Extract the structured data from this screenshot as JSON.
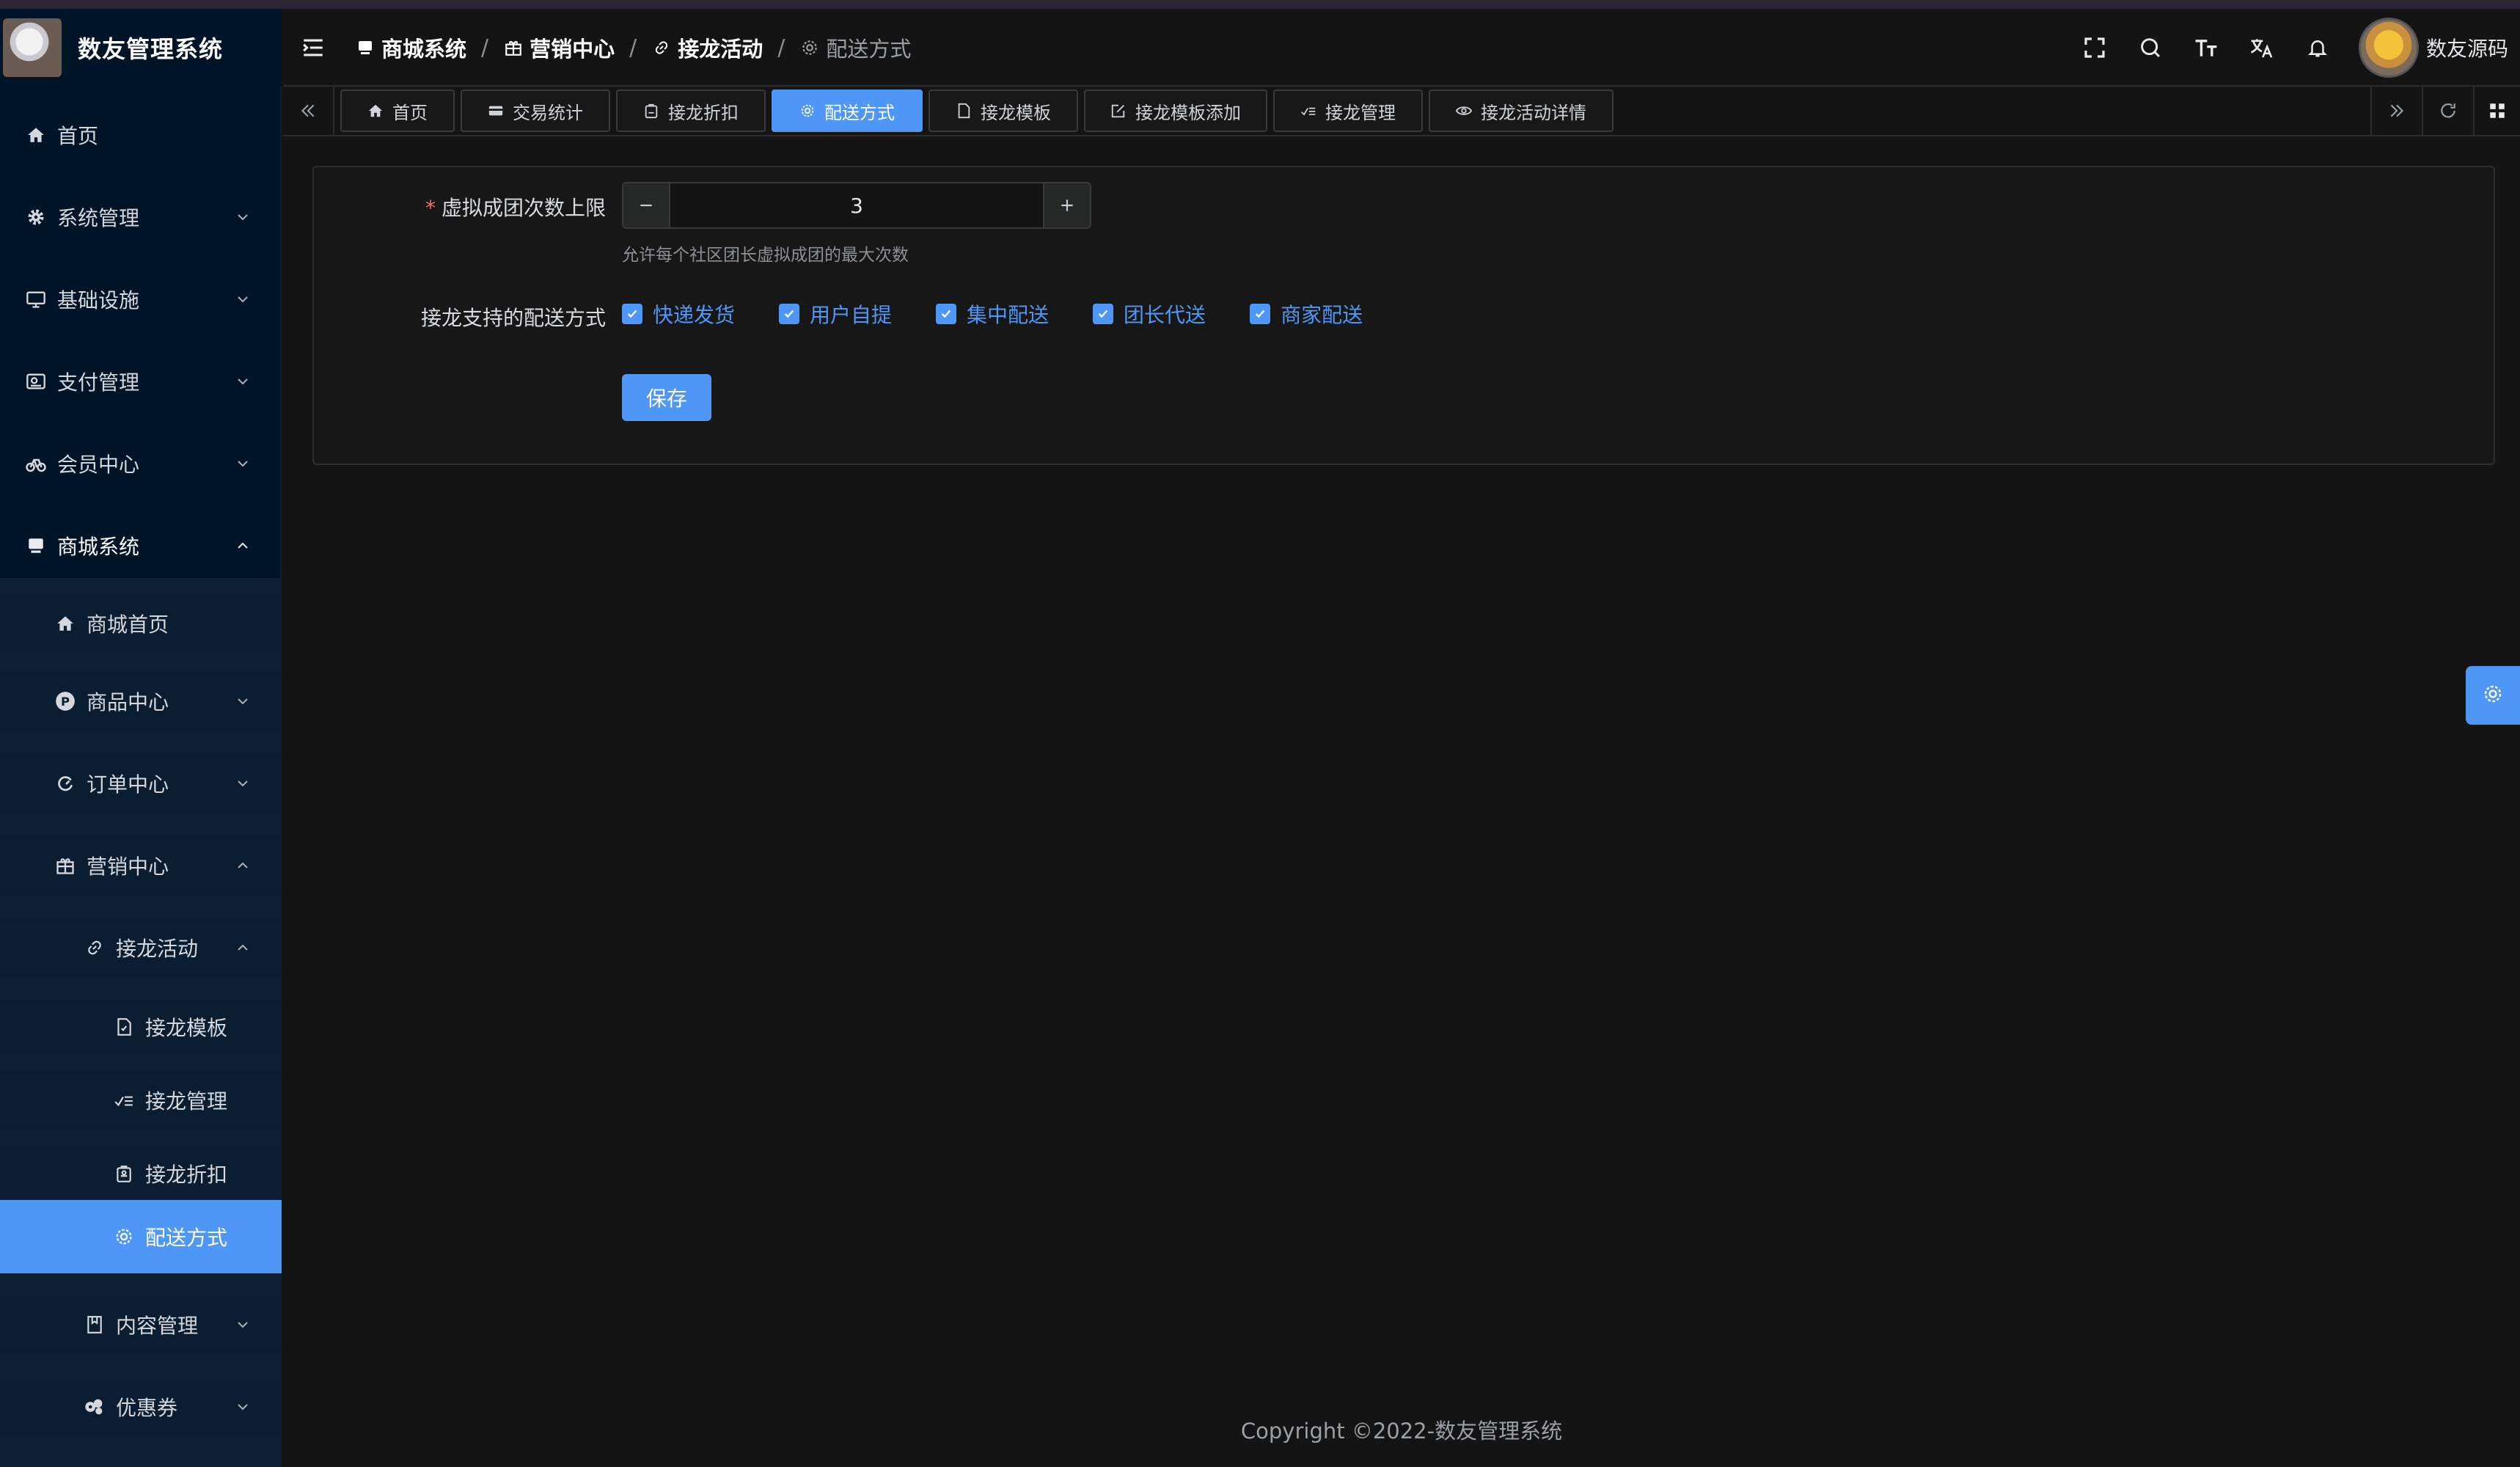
{
  "app": {
    "title": "数友管理系统"
  },
  "sidebar": {
    "items": [
      {
        "label": "首页",
        "icon": "home-icon"
      },
      {
        "label": "系统管理",
        "icon": "gear-icon"
      },
      {
        "label": "基础设施",
        "icon": "monitor-icon"
      },
      {
        "label": "支付管理",
        "icon": "wallet-icon"
      },
      {
        "label": "会员中心",
        "icon": "bicycle-icon"
      },
      {
        "label": "商城系统",
        "icon": "shop-icon"
      }
    ],
    "sub": {
      "mall_home": "商城首页",
      "product_center": "商品中心",
      "order_center": "订单中心",
      "marketing_center": "营销中心",
      "jielong_activity": "接龙活动",
      "jielong_template": "接龙模板",
      "jielong_manage": "接龙管理",
      "jielong_discount": "接龙折扣",
      "delivery_method": "配送方式",
      "content_manage": "内容管理",
      "coupon": "优惠券"
    }
  },
  "header": {
    "breadcrumb": [
      "商城系统",
      "营销中心",
      "接龙活动",
      "配送方式"
    ],
    "username": "数友源码"
  },
  "tabs": [
    "首页",
    "交易统计",
    "接龙折扣",
    "配送方式",
    "接龙模板",
    "接龙模板添加",
    "接龙管理",
    "接龙活动详情"
  ],
  "form": {
    "virtual_limit_label": "虚拟成团次数上限",
    "virtual_limit_value": "3",
    "virtual_limit_hint": "允许每个社区团长虚拟成团的最大次数",
    "delivery_label": "接龙支持的配送方式",
    "delivery_options": [
      "快递发货",
      "用户自提",
      "集中配送",
      "团长代送",
      "商家配送"
    ],
    "save_label": "保存"
  },
  "footer": {
    "copyright": "Copyright ©2022-数友管理系统"
  },
  "colors": {
    "accent": "#4f97f7",
    "sidebar_bg": "#001428",
    "page_bg": "#141414"
  }
}
